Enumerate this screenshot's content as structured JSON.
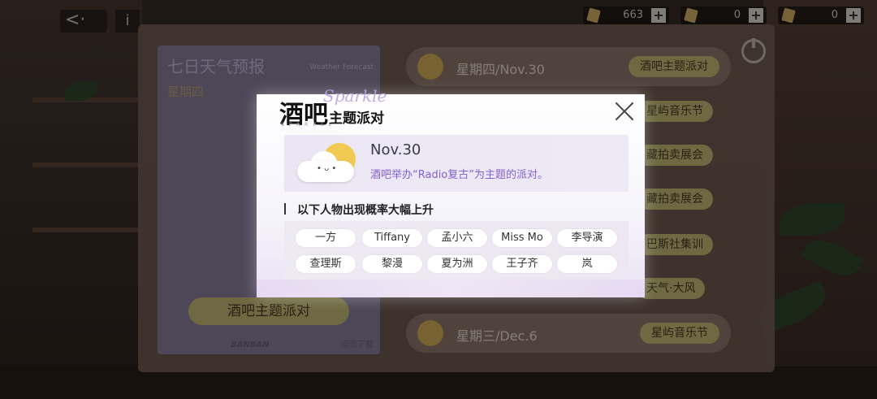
{
  "topbar": {
    "back_label": "<·",
    "info_label": "i",
    "resources": [
      {
        "icon": "diamond-icon",
        "value": "663",
        "plus": "+"
      },
      {
        "icon": "ticket-icon",
        "value": "0",
        "plus": "+"
      },
      {
        "icon": "card-icon",
        "value": "0",
        "plus": "+"
      }
    ]
  },
  "weather_card": {
    "title": "七日天气预报",
    "subtitle": "星期四",
    "en": "Weather Forecast",
    "button_label": "酒吧主题派对",
    "footer": "BANBAN",
    "footer2": "点击下载"
  },
  "day_list": [
    {
      "label": "星期四/Nov.30",
      "tag": "酒吧主题派对"
    },
    {
      "label": "星期三/Dec.6",
      "tag": "星屿音乐节"
    }
  ],
  "side_tags": [
    "星屿音乐节",
    "藏拍卖展会",
    "藏拍卖展会",
    "巴斯社集训",
    "天气·大风"
  ],
  "modal": {
    "title_big": "酒吧",
    "title_small": "主题派对",
    "script": "Sparkle",
    "sparkle": "SPARKLE",
    "event_date": "Nov.30",
    "event_desc": "酒吧举办“Radio复古”为主题的派对。",
    "section_header": "以下人物出现概率大幅上升",
    "characters": [
      "一方",
      "Tiffany",
      "孟小六",
      "Miss Mo",
      "李导演",
      "查理斯",
      "黎漫",
      "夏为洲",
      "王子齐",
      "岚"
    ]
  }
}
